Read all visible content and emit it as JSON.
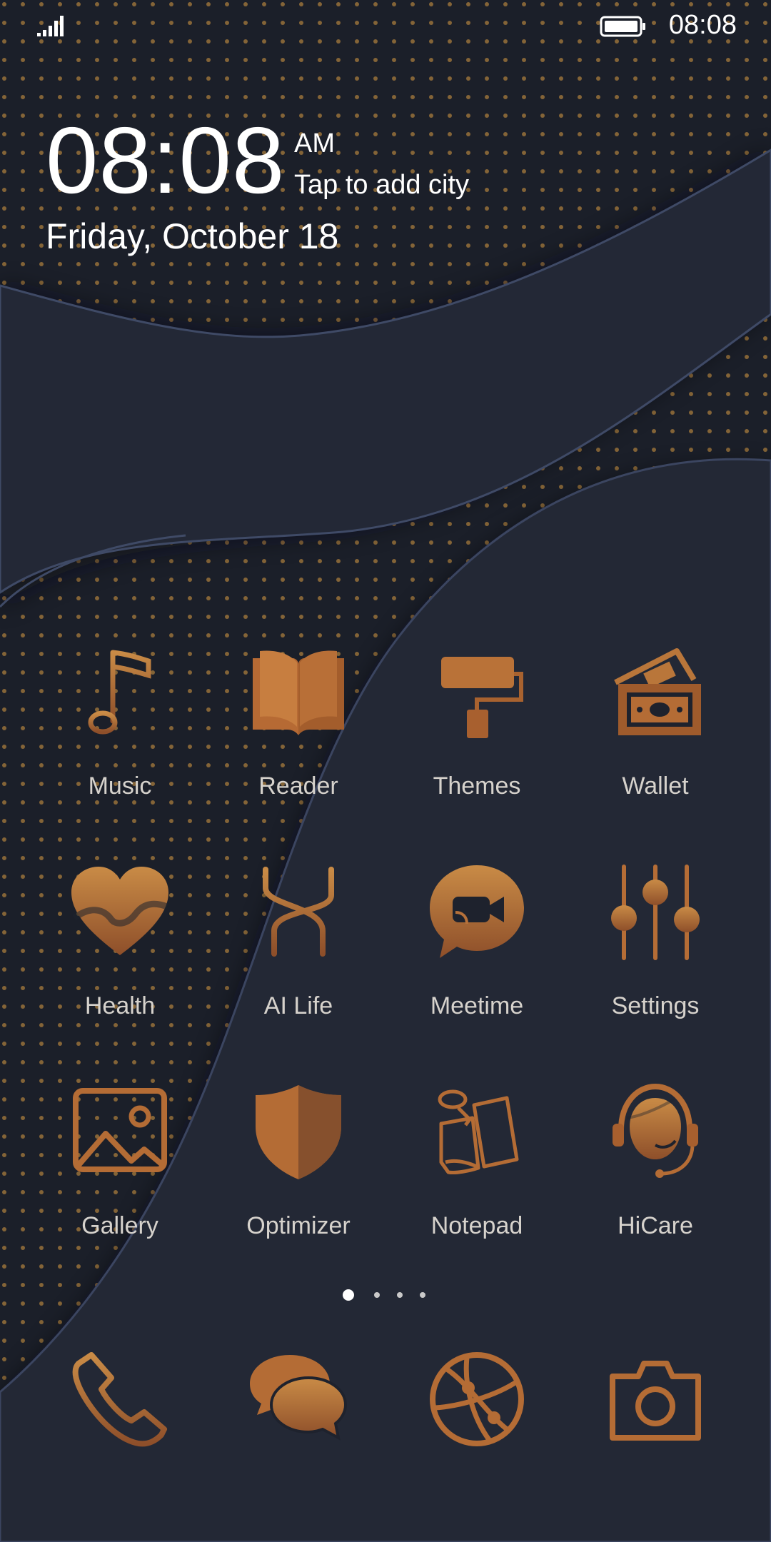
{
  "status_bar": {
    "time": "08:08",
    "battery_icon": "battery-full-icon",
    "signal_icon": "signal-icon"
  },
  "clock": {
    "time": "08:08",
    "period": "AM",
    "city_prompt": "Tap to add city",
    "date": "Friday, October 18"
  },
  "apps": [
    {
      "label": "Music",
      "icon": "music-note-icon"
    },
    {
      "label": "Reader",
      "icon": "book-icon"
    },
    {
      "label": "Themes",
      "icon": "paint-roller-icon"
    },
    {
      "label": "Wallet",
      "icon": "wallet-icon"
    },
    {
      "label": "Health",
      "icon": "heart-icon"
    },
    {
      "label": "AI Life",
      "icon": "ai-life-icon"
    },
    {
      "label": "Meetime",
      "icon": "video-chat-icon"
    },
    {
      "label": "Settings",
      "icon": "sliders-icon"
    },
    {
      "label": "Gallery",
      "icon": "image-icon"
    },
    {
      "label": "Optimizer",
      "icon": "shield-icon"
    },
    {
      "label": "Notepad",
      "icon": "notepad-icon"
    },
    {
      "label": "HiCare",
      "icon": "support-agent-icon"
    }
  ],
  "page_indicator": {
    "count": 4,
    "active_index": 0
  },
  "dock": [
    {
      "name": "phone",
      "icon": "phone-icon"
    },
    {
      "name": "messages",
      "icon": "messages-icon"
    },
    {
      "name": "browser",
      "icon": "browser-icon"
    },
    {
      "name": "camera",
      "icon": "camera-icon"
    }
  ],
  "colors": {
    "background": "#1e222d",
    "accent": "#b8733a",
    "label": "#d6d2cc"
  }
}
